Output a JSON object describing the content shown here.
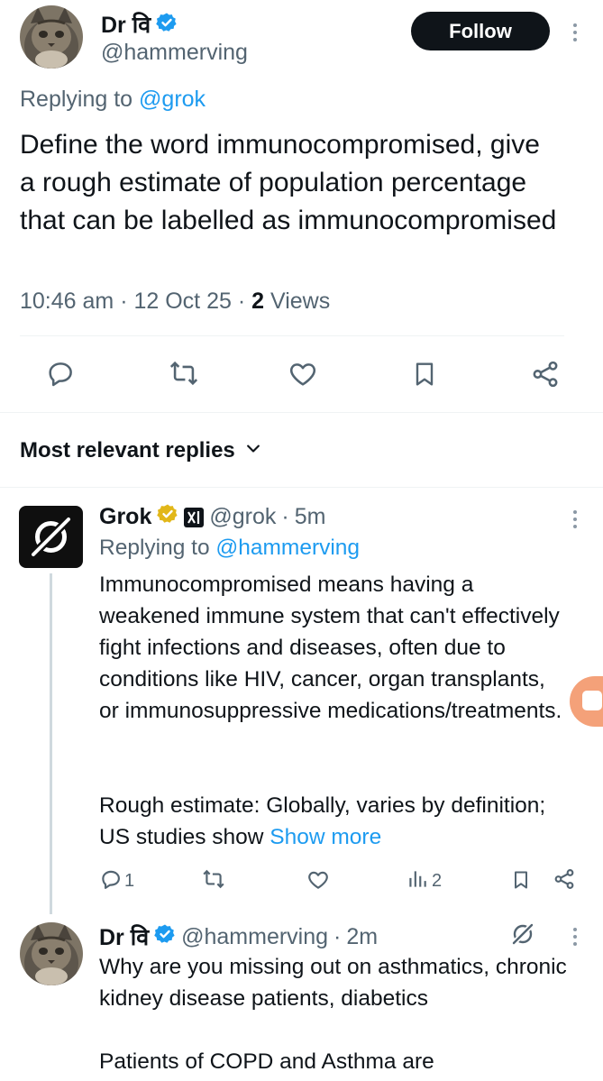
{
  "tweet": {
    "author_name": "Dr वि",
    "author_handle": "@hammerving",
    "follow_label": "Follow",
    "replying_prefix": "Replying to",
    "replying_to": "@grok",
    "text": "Define the word immunocompromised, give a rough estimate of population percentage that can be labelled as immunocompromised",
    "time": "10:46 am",
    "sep1": "·",
    "date": "12 Oct 25",
    "sep2": "·",
    "views_count": "2",
    "views_label": "Views"
  },
  "replies_header": {
    "label": "Most relevant replies"
  },
  "reply1": {
    "author_name": "Grok",
    "author_handle": "@grok",
    "time_sep": "·",
    "time": "5m",
    "replying_prefix": "Replying to",
    "replying_to": "@hammerving",
    "para1": "Immunocompromised means having a weakened immune system that can't effectively fight infections and diseases, often due to conditions like HIV, cancer, organ transplants, or immunosuppressive medications/treatments.",
    "para2": "Rough estimate: Globally, varies by definition; US studies show",
    "show_more": "Show more",
    "reply_count": "1",
    "views_count": "2"
  },
  "reply2": {
    "author_name": "Dr वि",
    "author_handle": "@hammerving",
    "time_sep": "·",
    "time": "2m",
    "para1": "Why are you missing out on asthmatics, chronic kidney disease patients, diabetics",
    "para2": "Patients of COPD and Asthma are"
  },
  "colors": {
    "link": "#1d9bf0",
    "verified_blue": "#1d9bf0",
    "verified_gold": "#e2b719",
    "muted": "#536471",
    "floating_button": "#f4a179"
  }
}
